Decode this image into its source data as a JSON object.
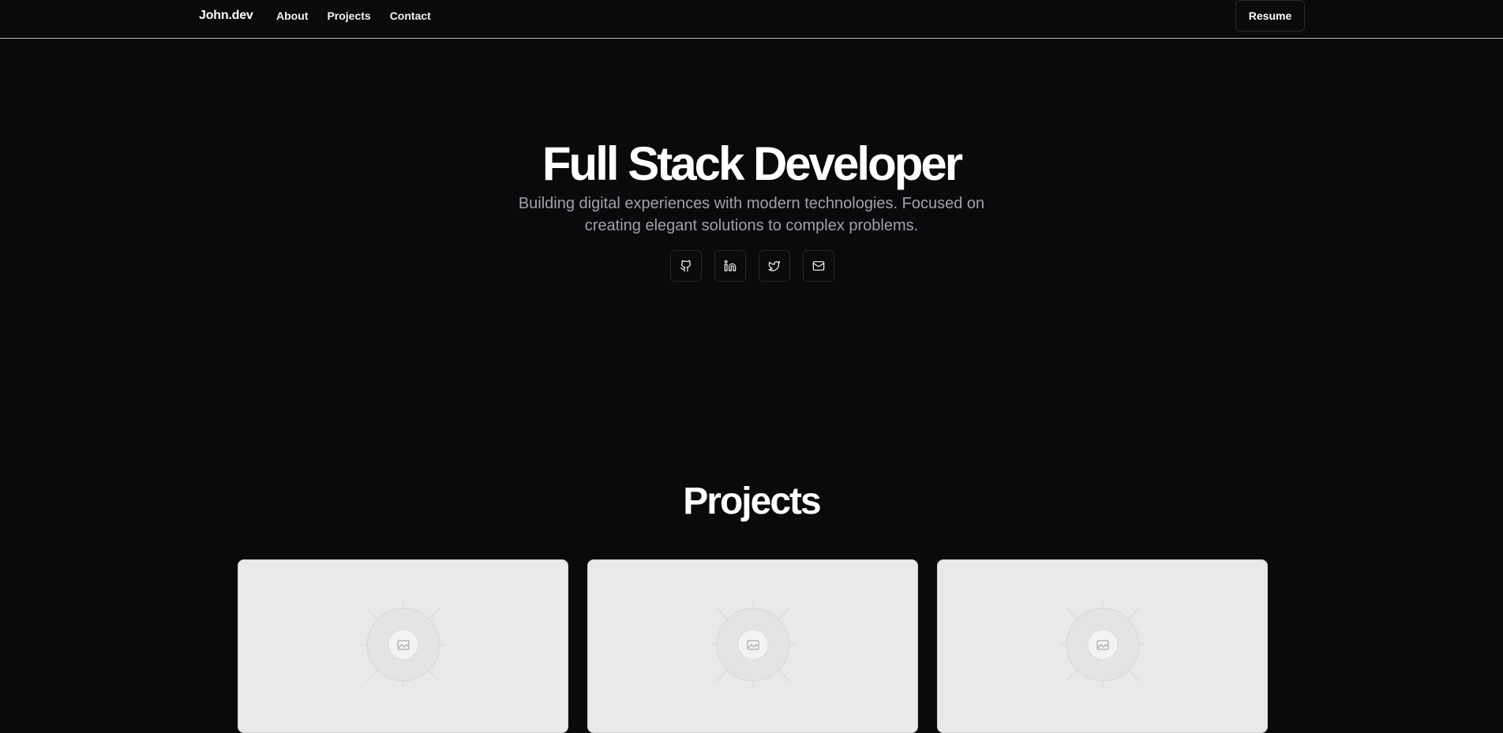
{
  "nav": {
    "brand": "John.dev",
    "links": [
      "About",
      "Projects",
      "Contact"
    ],
    "resume_label": "Resume"
  },
  "hero": {
    "title": "Full Stack Developer",
    "subtitle": "Building digital experiences with modern technologies. Focused on creating elegant solutions to complex problems.",
    "socials": [
      {
        "icon": "github-icon"
      },
      {
        "icon": "linkedin-icon"
      },
      {
        "icon": "twitter-icon"
      },
      {
        "icon": "mail-icon"
      }
    ]
  },
  "projects": {
    "title": "Projects",
    "cards": [
      {
        "image": "placeholder-image-icon"
      },
      {
        "image": "placeholder-image-icon"
      },
      {
        "image": "placeholder-image-icon"
      }
    ]
  },
  "colors": {
    "background": "#0a0a0c",
    "text": "#ffffff",
    "muted": "#a1a1aa",
    "card": "#e9e9e9"
  }
}
